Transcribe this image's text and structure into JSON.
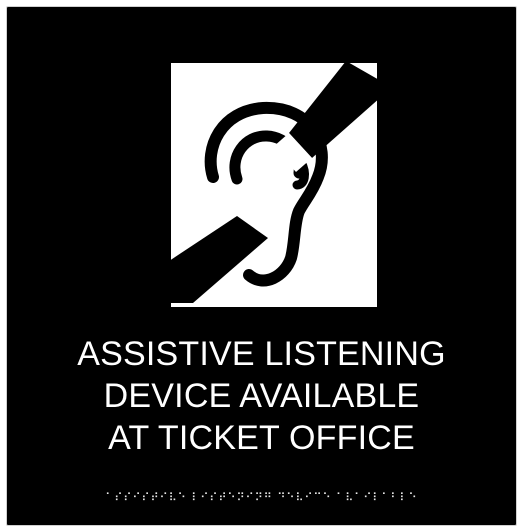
{
  "sign": {
    "background_color": "#000000",
    "text_color": "#ffffff",
    "symbol": {
      "icon": "hearing-loss-assistance-icon",
      "panel_color": "#ffffff",
      "icon_color": "#000000"
    },
    "lines": [
      "ASSISTIVE LISTENING",
      "DEVICE AVAILABLE",
      "AT TICKET OFFICE"
    ],
    "braille": "⠁⠎⠎⠊⠎⠞⠊⠧⠑ ⠇⠊⠎⠞⠑⠝⠊⠝⠛ ⠙⠑⠧⠊⠉⠑ ⠁⠧⠁⠊⠇⠁⠃⠇⠑"
  }
}
